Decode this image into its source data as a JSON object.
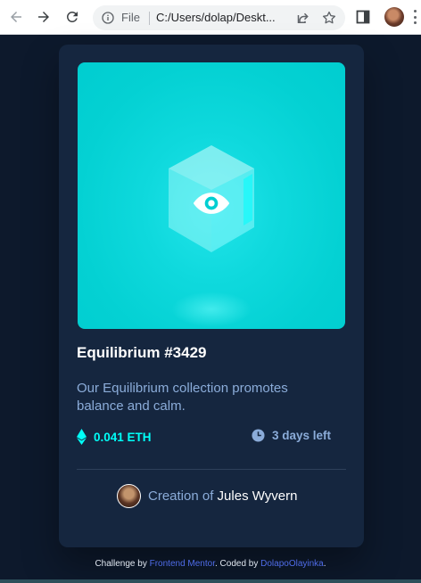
{
  "browser": {
    "file_label": "File",
    "url": "C:/Users/dolap/Deskt..."
  },
  "card": {
    "title": "Equilibrium #3429",
    "description": "Our Equilibrium collection promotes balance and calm.",
    "price": "0.041 ETH",
    "time_left": "3 days left",
    "creator_prefix": "Creation of ",
    "creator_name": "Jules Wyvern"
  },
  "attribution": {
    "challenge_by": "Challenge by",
    "frontend_mentor": "Frontend Mentor",
    "coded_by": ". Coded by",
    "author": "DolapoOlayinka",
    "end": "."
  },
  "colors": {
    "page_bg": "#0d192c",
    "card_bg": "#15263f",
    "cyan": "#00fff8",
    "soft_blue": "#8bacd9",
    "link": "#4f6ce8"
  },
  "icons": [
    "back-arrow-icon",
    "forward-arrow-icon",
    "reload-icon",
    "info-icon",
    "share-icon",
    "star-icon",
    "side-panel-icon",
    "kebab-menu-icon",
    "view-eye-icon",
    "ethereum-icon",
    "clock-icon"
  ]
}
